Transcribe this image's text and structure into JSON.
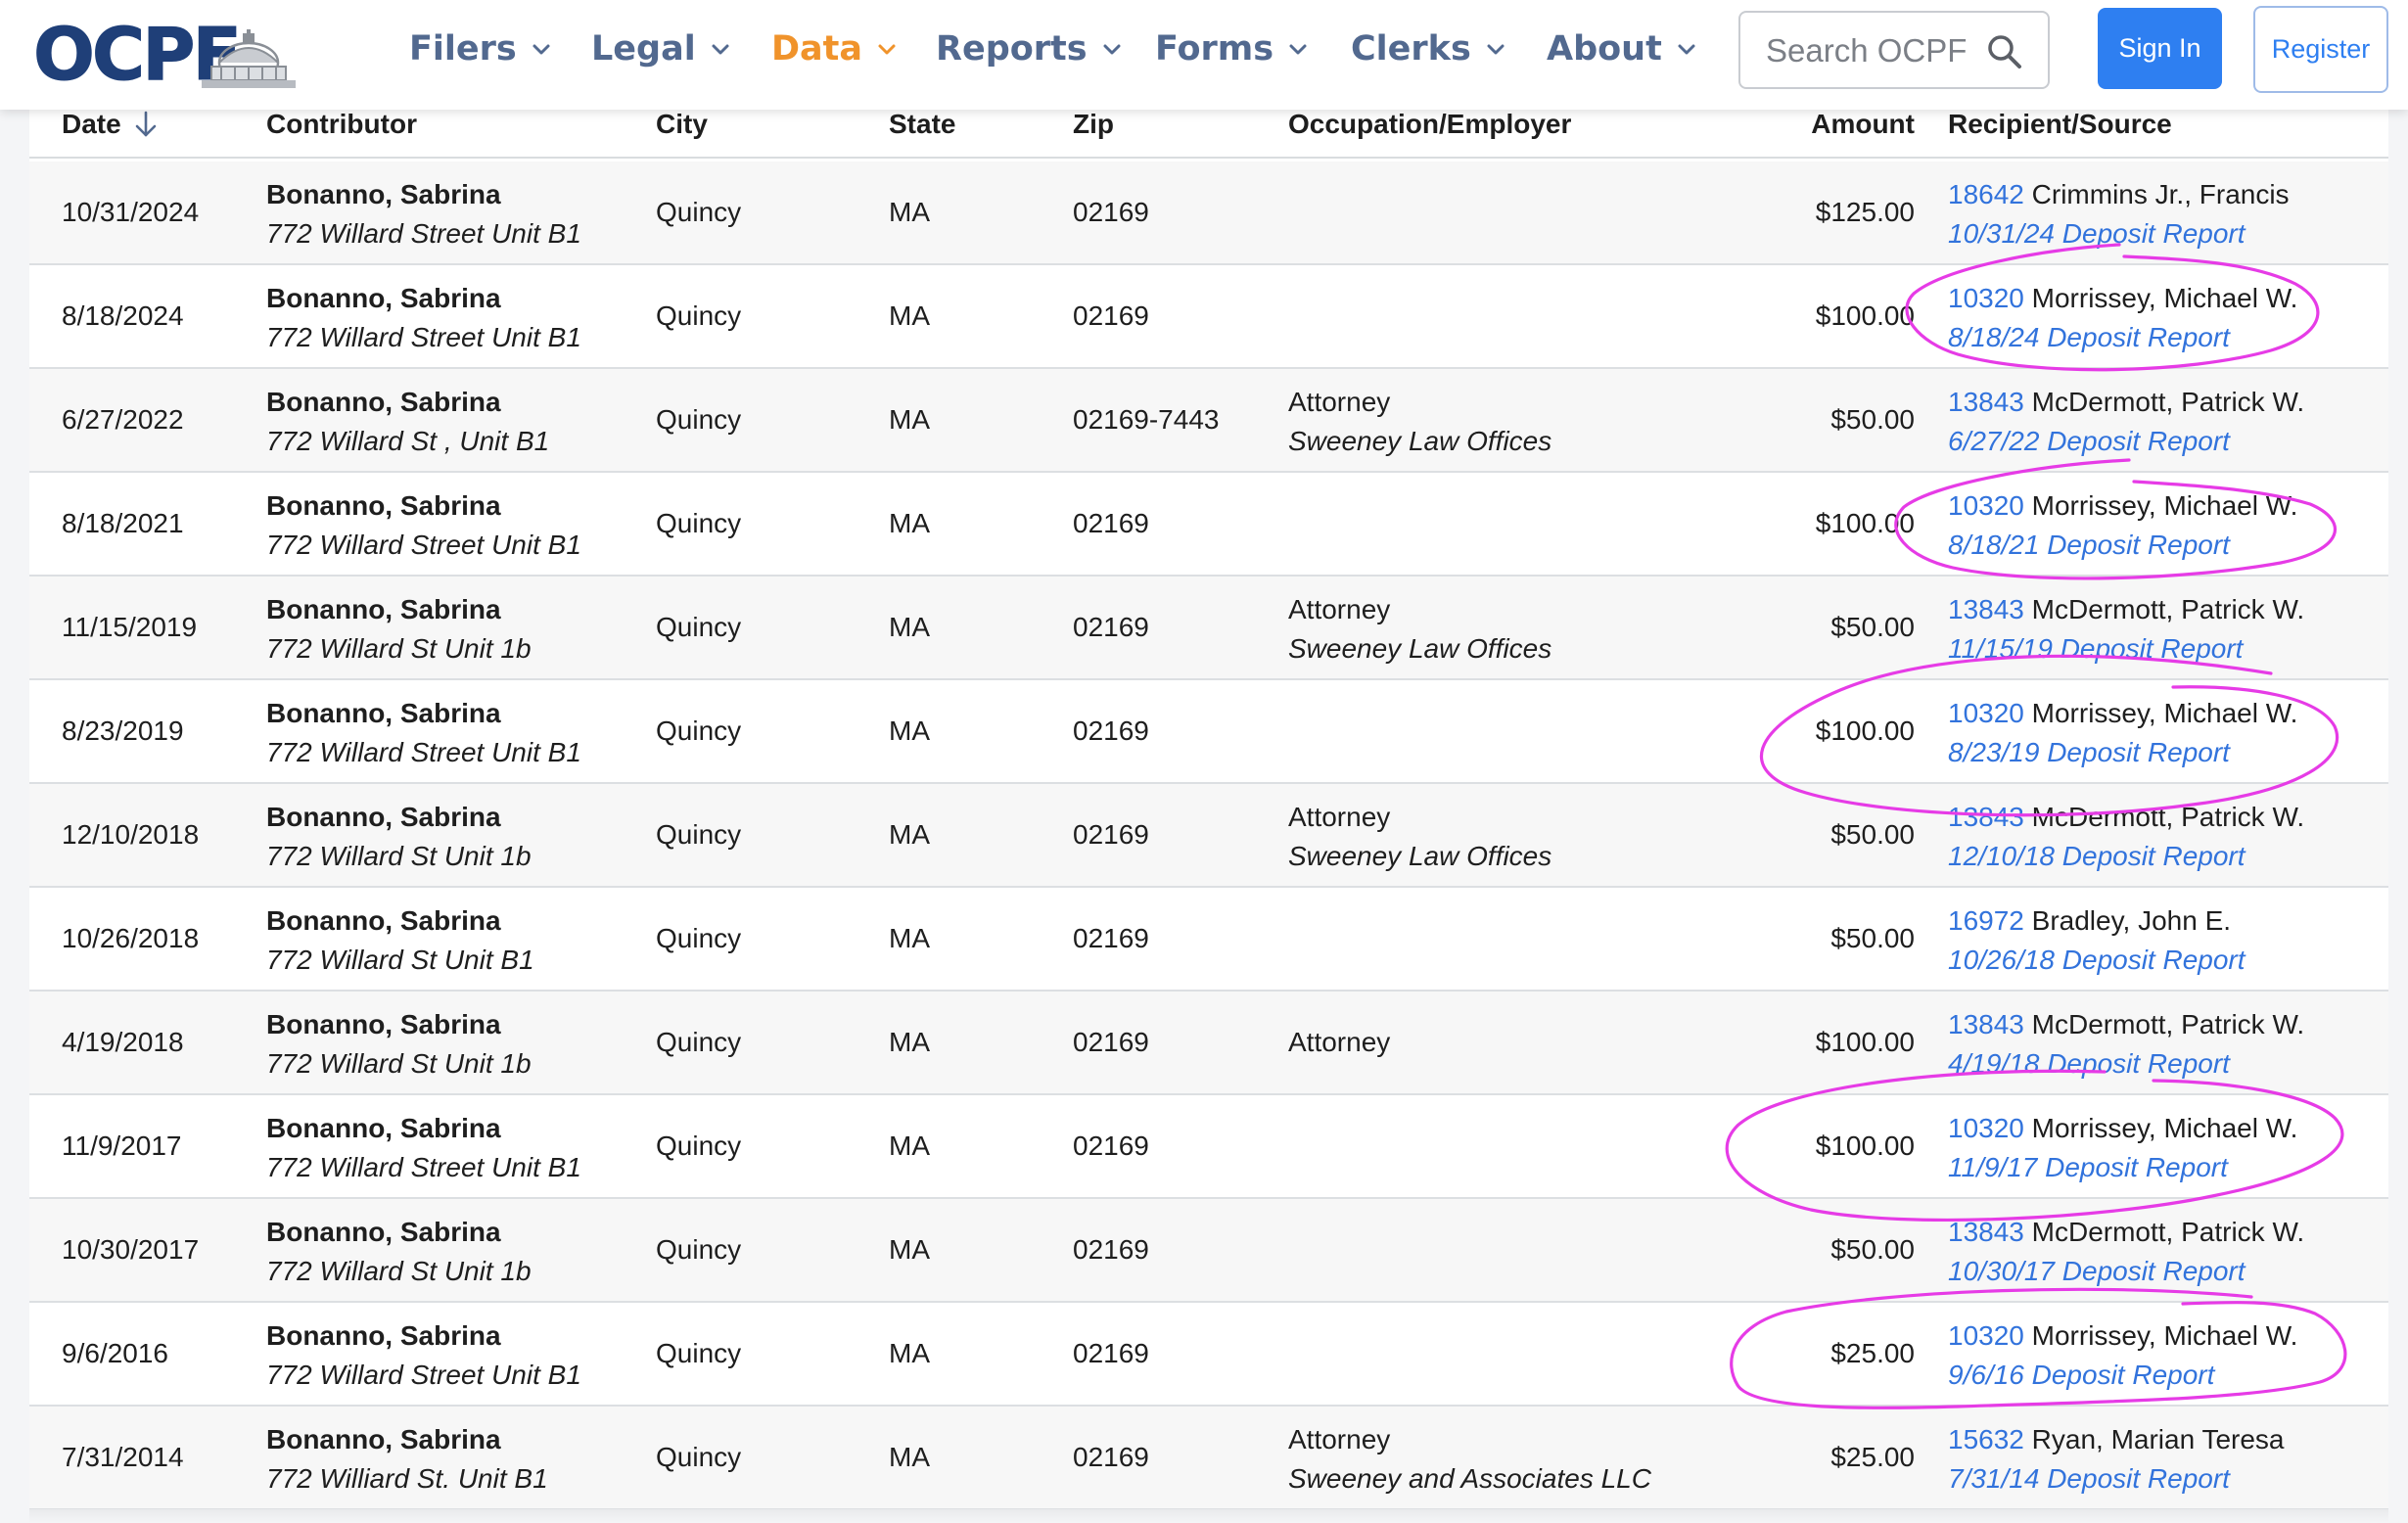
{
  "brand": {
    "logo_text": "OCPF"
  },
  "nav": {
    "items": [
      {
        "label": "Filers",
        "active": false
      },
      {
        "label": "Legal",
        "active": false
      },
      {
        "label": "Data",
        "active": true
      },
      {
        "label": "Reports",
        "active": false
      },
      {
        "label": "Forms",
        "active": false
      },
      {
        "label": "Clerks",
        "active": false
      },
      {
        "label": "About",
        "active": false
      }
    ],
    "search_placeholder": "Search OCPF",
    "sign_in_label": "Sign In",
    "register_label": "Register"
  },
  "colors": {
    "nav_text": "#52698f",
    "nav_active": "#f0932b",
    "link": "#3273dc",
    "primary_button": "#2e7ff1",
    "annotation": "#e63be6"
  },
  "table": {
    "columns": {
      "date": "Date",
      "contributor": "Contributor",
      "city": "City",
      "state": "State",
      "zip": "Zip",
      "occupation": "Occupation/Employer",
      "amount": "Amount",
      "recipient": "Recipient/Source"
    },
    "sort": {
      "column": "date",
      "direction": "descending",
      "icon": "arrow-down-icon"
    },
    "rows": [
      {
        "date": "10/31/2024",
        "name": "Bonanno, Sabrina",
        "address": "772 Willard Street Unit B1",
        "city": "Quincy",
        "state": "MA",
        "zip": "02169",
        "occupation": "",
        "employer": "",
        "amount": "$125.00",
        "cpf_id": "18642",
        "recipient": "Crimmins Jr., Francis",
        "report": "10/31/24 Deposit Report",
        "circled": false
      },
      {
        "date": "8/18/2024",
        "name": "Bonanno, Sabrina",
        "address": "772 Willard Street Unit B1",
        "city": "Quincy",
        "state": "MA",
        "zip": "02169",
        "occupation": "",
        "employer": "",
        "amount": "$100.00",
        "cpf_id": "10320",
        "recipient": "Morrissey, Michael W.",
        "report": "8/18/24 Deposit Report",
        "circled": true
      },
      {
        "date": "6/27/2022",
        "name": "Bonanno, Sabrina",
        "address": "772 Willard St , Unit B1",
        "city": "Quincy",
        "state": "MA",
        "zip": "02169-7443",
        "occupation": "Attorney",
        "employer": "Sweeney Law Offices",
        "amount": "$50.00",
        "cpf_id": "13843",
        "recipient": "McDermott, Patrick W.",
        "report": "6/27/22 Deposit Report",
        "circled": false
      },
      {
        "date": "8/18/2021",
        "name": "Bonanno, Sabrina",
        "address": "772 Willard Street Unit B1",
        "city": "Quincy",
        "state": "MA",
        "zip": "02169",
        "occupation": "",
        "employer": "",
        "amount": "$100.00",
        "cpf_id": "10320",
        "recipient": "Morrissey, Michael W.",
        "report": "8/18/21 Deposit Report",
        "circled": true
      },
      {
        "date": "11/15/2019",
        "name": "Bonanno, Sabrina",
        "address": "772 Willard St Unit 1b",
        "city": "Quincy",
        "state": "MA",
        "zip": "02169",
        "occupation": "Attorney",
        "employer": "Sweeney Law Offices",
        "amount": "$50.00",
        "cpf_id": "13843",
        "recipient": "McDermott, Patrick W.",
        "report": "11/15/19 Deposit Report",
        "circled": false
      },
      {
        "date": "8/23/2019",
        "name": "Bonanno, Sabrina",
        "address": "772 Willard Street Unit B1",
        "city": "Quincy",
        "state": "MA",
        "zip": "02169",
        "occupation": "",
        "employer": "",
        "amount": "$100.00",
        "cpf_id": "10320",
        "recipient": "Morrissey, Michael W.",
        "report": "8/23/19 Deposit Report",
        "circled": true
      },
      {
        "date": "12/10/2018",
        "name": "Bonanno, Sabrina",
        "address": "772 Willard St Unit 1b",
        "city": "Quincy",
        "state": "MA",
        "zip": "02169",
        "occupation": "Attorney",
        "employer": "Sweeney Law Offices",
        "amount": "$50.00",
        "cpf_id": "13843",
        "recipient": "McDermott, Patrick W.",
        "report": "12/10/18 Deposit Report",
        "circled": false
      },
      {
        "date": "10/26/2018",
        "name": "Bonanno, Sabrina",
        "address": "772 Willard St Unit B1",
        "city": "Quincy",
        "state": "MA",
        "zip": "02169",
        "occupation": "",
        "employer": "",
        "amount": "$50.00",
        "cpf_id": "16972",
        "recipient": "Bradley, John E.",
        "report": "10/26/18 Deposit Report",
        "circled": false
      },
      {
        "date": "4/19/2018",
        "name": "Bonanno, Sabrina",
        "address": "772 Willard St Unit 1b",
        "city": "Quincy",
        "state": "MA",
        "zip": "02169",
        "occupation": "Attorney",
        "employer": "",
        "amount": "$100.00",
        "cpf_id": "13843",
        "recipient": "McDermott, Patrick W.",
        "report": "4/19/18 Deposit Report",
        "circled": false
      },
      {
        "date": "11/9/2017",
        "name": "Bonanno, Sabrina",
        "address": "772 Willard Street Unit B1",
        "city": "Quincy",
        "state": "MA",
        "zip": "02169",
        "occupation": "",
        "employer": "",
        "amount": "$100.00",
        "cpf_id": "10320",
        "recipient": "Morrissey, Michael W.",
        "report": "11/9/17 Deposit Report",
        "circled": true
      },
      {
        "date": "10/30/2017",
        "name": "Bonanno, Sabrina",
        "address": "772 Willard St Unit 1b",
        "city": "Quincy",
        "state": "MA",
        "zip": "02169",
        "occupation": "",
        "employer": "",
        "amount": "$50.00",
        "cpf_id": "13843",
        "recipient": "McDermott, Patrick W.",
        "report": "10/30/17 Deposit Report",
        "circled": false
      },
      {
        "date": "9/6/2016",
        "name": "Bonanno, Sabrina",
        "address": "772 Willard Street Unit B1",
        "city": "Quincy",
        "state": "MA",
        "zip": "02169",
        "occupation": "",
        "employer": "",
        "amount": "$25.00",
        "cpf_id": "10320",
        "recipient": "Morrissey, Michael W.",
        "report": "9/6/16 Deposit Report",
        "circled": true
      },
      {
        "date": "7/31/2014",
        "name": "Bonanno, Sabrina",
        "address": "772 Williard St. Unit B1",
        "city": "Quincy",
        "state": "MA",
        "zip": "02169",
        "occupation": "Attorney",
        "employer": "Sweeney and Associates LLC",
        "amount": "$25.00",
        "cpf_id": "15632",
        "recipient": "Ryan, Marian Teresa",
        "report": "7/31/14 Deposit Report",
        "circled": false
      }
    ]
  }
}
